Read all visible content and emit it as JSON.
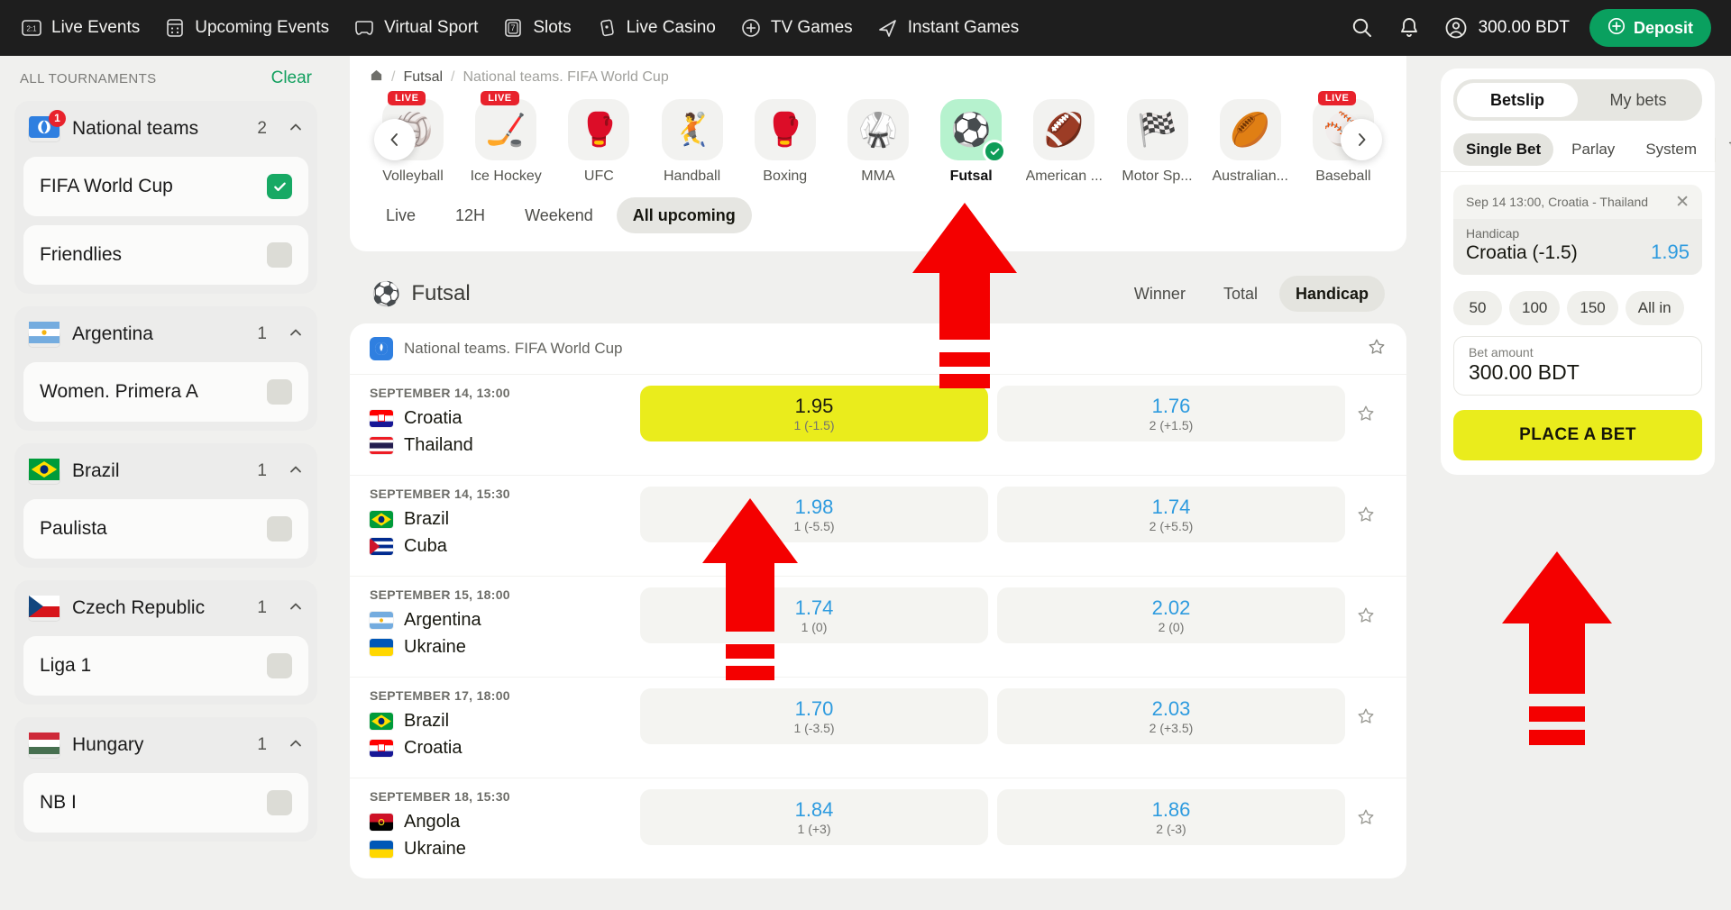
{
  "topnav": {
    "items": [
      {
        "label": "Live Events",
        "icon": "live-events-icon"
      },
      {
        "label": "Upcoming Events",
        "icon": "calendar-icon"
      },
      {
        "label": "Virtual Sport",
        "icon": "gamepad-icon"
      },
      {
        "label": "Slots",
        "icon": "slots-icon"
      },
      {
        "label": "Live Casino",
        "icon": "cards-icon"
      },
      {
        "label": "TV Games",
        "icon": "tv-games-icon"
      },
      {
        "label": "Instant Games",
        "icon": "rocket-icon"
      }
    ],
    "search_icon": "search-icon",
    "bell_icon": "bell-icon",
    "account_icon": "account-icon",
    "balance": "300.00 BDT",
    "deposit_label": "Deposit",
    "deposit_color": "#0aa05f"
  },
  "sidebar": {
    "title": "ALL TOURNAMENTS",
    "clear_label": "Clear",
    "groups": [
      {
        "name": "National teams",
        "count": "2",
        "flag": "world",
        "badge": "1",
        "items": [
          {
            "label": "FIFA World Cup",
            "checked": true
          },
          {
            "label": "Friendlies",
            "checked": false
          }
        ]
      },
      {
        "name": "Argentina",
        "count": "1",
        "flag": "ar",
        "badge": "",
        "items": [
          {
            "label": "Women. Primera A",
            "checked": false
          }
        ]
      },
      {
        "name": "Brazil",
        "count": "1",
        "flag": "br",
        "badge": "",
        "items": [
          {
            "label": "Paulista",
            "checked": false
          }
        ]
      },
      {
        "name": "Czech Republic",
        "count": "1",
        "flag": "cz",
        "badge": "",
        "items": [
          {
            "label": "Liga 1",
            "checked": false
          }
        ]
      },
      {
        "name": "Hungary",
        "count": "1",
        "flag": "hu",
        "badge": "",
        "items": [
          {
            "label": "NB I",
            "checked": false
          }
        ]
      }
    ]
  },
  "main": {
    "breadcrumb": {
      "home_icon": "home-icon",
      "sport": "Futsal",
      "current": "National teams. FIFA World Cup"
    },
    "sports": [
      {
        "label": "Volleyball",
        "emoji": "🏐",
        "live": true,
        "active": false
      },
      {
        "label": "Ice Hockey",
        "emoji": "🏒",
        "live": true,
        "active": false
      },
      {
        "label": "UFC",
        "emoji": "🥊",
        "live": false,
        "active": false
      },
      {
        "label": "Handball",
        "emoji": "🤾",
        "live": false,
        "active": false
      },
      {
        "label": "Boxing",
        "emoji": "🥊",
        "live": false,
        "active": false
      },
      {
        "label": "MMA",
        "emoji": "🥋",
        "live": false,
        "active": false
      },
      {
        "label": "Futsal",
        "emoji": "⚽",
        "live": false,
        "active": true
      },
      {
        "label": "American ...",
        "emoji": "🏈",
        "live": false,
        "active": false
      },
      {
        "label": "Motor Sp...",
        "emoji": "🏁",
        "live": false,
        "active": false
      },
      {
        "label": "Australian...",
        "emoji": "🏉",
        "live": false,
        "active": false
      },
      {
        "label": "Baseball",
        "emoji": "⚾",
        "live": true,
        "active": false
      }
    ],
    "prev_icon": "chevron-left-icon",
    "next_icon": "chevron-right-icon",
    "time_filters": [
      {
        "label": "Live",
        "active": false
      },
      {
        "label": "12H",
        "active": false
      },
      {
        "label": "Weekend",
        "active": false
      },
      {
        "label": "All upcoming",
        "active": true
      }
    ],
    "section": {
      "icon": "⚽",
      "title": "Futsal"
    },
    "market_tabs": [
      {
        "label": "Winner",
        "active": false
      },
      {
        "label": "Total",
        "active": false
      },
      {
        "label": "Handicap",
        "active": true
      }
    ],
    "league": {
      "name": "National teams. FIFA World Cup",
      "star_icon": "star-outline-icon"
    },
    "matches": [
      {
        "date": "SEPTEMBER 14, 13:00",
        "home": {
          "name": "Croatia",
          "flag": "hr"
        },
        "away": {
          "name": "Thailand",
          "flag": "th"
        },
        "odds": [
          {
            "value": "1.95",
            "sub": "1 (-1.5)",
            "selected": true
          },
          {
            "value": "1.76",
            "sub": "2 (+1.5)",
            "selected": false
          }
        ]
      },
      {
        "date": "SEPTEMBER 14, 15:30",
        "home": {
          "name": "Brazil",
          "flag": "br"
        },
        "away": {
          "name": "Cuba",
          "flag": "cu"
        },
        "odds": [
          {
            "value": "1.98",
            "sub": "1 (-5.5)",
            "selected": false
          },
          {
            "value": "1.74",
            "sub": "2 (+5.5)",
            "selected": false
          }
        ]
      },
      {
        "date": "SEPTEMBER 15, 18:00",
        "home": {
          "name": "Argentina",
          "flag": "ar"
        },
        "away": {
          "name": "Ukraine",
          "flag": "ua"
        },
        "odds": [
          {
            "value": "1.74",
            "sub": "1 (0)",
            "selected": false
          },
          {
            "value": "2.02",
            "sub": "2 (0)",
            "selected": false
          }
        ]
      },
      {
        "date": "SEPTEMBER 17, 18:00",
        "home": {
          "name": "Brazil",
          "flag": "br"
        },
        "away": {
          "name": "Croatia",
          "flag": "hr"
        },
        "odds": [
          {
            "value": "1.70",
            "sub": "1 (-3.5)",
            "selected": false
          },
          {
            "value": "2.03",
            "sub": "2 (+3.5)",
            "selected": false
          }
        ]
      },
      {
        "date": "SEPTEMBER 18, 15:30",
        "home": {
          "name": "Angola",
          "flag": "ao"
        },
        "away": {
          "name": "Ukraine",
          "flag": "ua"
        },
        "odds": [
          {
            "value": "1.84",
            "sub": "1 (+3)",
            "selected": false
          },
          {
            "value": "1.86",
            "sub": "2 (-3)",
            "selected": false
          }
        ]
      }
    ]
  },
  "betslip": {
    "tabs": [
      {
        "label": "Betslip",
        "active": true
      },
      {
        "label": "My bets",
        "active": false
      }
    ],
    "modes": [
      {
        "label": "Single Bet",
        "active": true
      },
      {
        "label": "Parlay",
        "active": false
      },
      {
        "label": "System",
        "active": false
      }
    ],
    "trash_icon": "trash-icon",
    "pick": {
      "event": "Sep 14 13:00, Croatia - Thailand",
      "close_icon": "close-icon",
      "market": "Handicap",
      "selection": "Croatia (-1.5)",
      "odd": "1.95"
    },
    "quick_amounts": [
      "50",
      "100",
      "150",
      "All in"
    ],
    "amount_label": "Bet amount",
    "amount_value": "300.00 BDT",
    "place_label": "PLACE A BET",
    "accent_yellow": "#eaec1c"
  }
}
